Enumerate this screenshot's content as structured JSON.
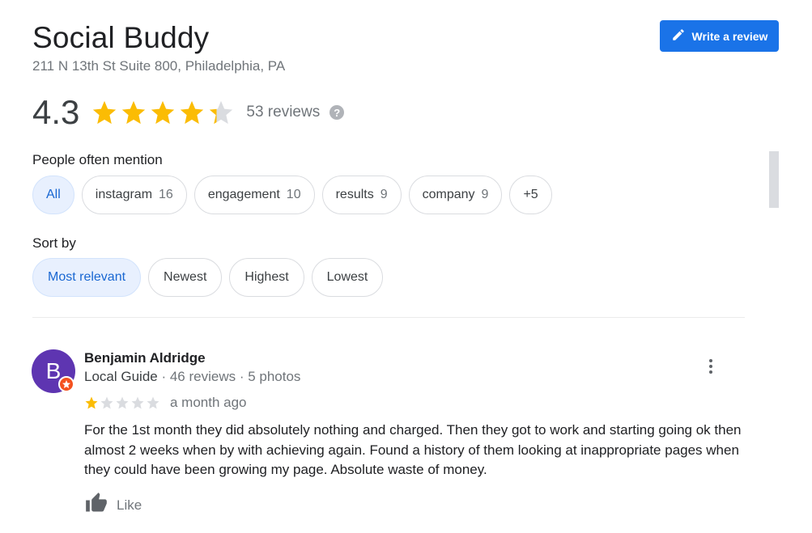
{
  "business": {
    "name": "Social Buddy",
    "address": "211 N 13th St Suite 800, Philadelphia, PA"
  },
  "write_review": {
    "label": "Write a review",
    "icon": "pencil-icon"
  },
  "rating": {
    "value": "4.3",
    "stars": 4.3,
    "review_count": "53 reviews",
    "help_icon": "?"
  },
  "mentions": {
    "label": "People often mention",
    "chips": [
      {
        "label": "All",
        "count": "",
        "active": true
      },
      {
        "label": "instagram",
        "count": "16",
        "active": false
      },
      {
        "label": "engagement",
        "count": "10",
        "active": false
      },
      {
        "label": "results",
        "count": "9",
        "active": false
      },
      {
        "label": "company",
        "count": "9",
        "active": false
      },
      {
        "label": "+5",
        "count": "",
        "active": false
      }
    ]
  },
  "sort": {
    "label": "Sort by",
    "options": [
      {
        "label": "Most relevant",
        "active": true
      },
      {
        "label": "Newest",
        "active": false
      },
      {
        "label": "Highest",
        "active": false
      },
      {
        "label": "Lowest",
        "active": false
      }
    ]
  },
  "review": {
    "avatar_letter": "B",
    "avatar_color": "#5e35b1",
    "name": "Benjamin Aldridge",
    "local_guide": "Local Guide",
    "meta": " · 46 reviews · 5 photos",
    "stars": 1,
    "date": "a month ago",
    "text": "For the 1st month they did absolutely nothing and charged. Then they got to work and starting going ok then almost 2 weeks when by with achieving again. Found a history of them looking at inappropriate pages when they could have been growing my page. Absolute waste of money.",
    "like_label": "Like"
  },
  "colors": {
    "star": "#fbbc04",
    "star_empty": "#dadce0",
    "accent": "#1a73e8"
  }
}
